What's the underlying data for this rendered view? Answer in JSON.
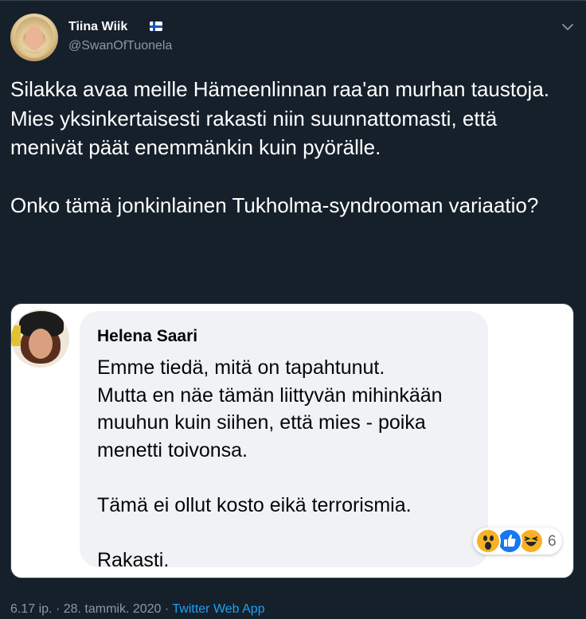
{
  "tweet": {
    "author_name": "Tiina Wiik",
    "author_handle": "@SwanOfTuonela",
    "text": "Silakka avaa meille Hämeenlinnan raa'an murhan taustoja. Mies yksinkertaisesti rakasti niin suunnattomasti, että menivät päät enemmänkin kuin pyörälle.\n\nOnko tämä jonkinlainen Tukholma-syndrooman variaatio?",
    "time": "6.17 ip.",
    "separator": "·",
    "date": "28. tammik. 2020",
    "source": "Twitter Web App"
  },
  "embedded_comment": {
    "name": "Helena Saari",
    "text": "Emme tiedä, mitä on tapahtunut.\nMutta en näe tämän liittyvän mihinkään muuhun kuin siihen, että mies - poika menetti toivonsa.\n\nTämä ei ollut kosto eikä terrorismia.\n\nRakasti.",
    "reaction_count": "6",
    "reactions": [
      "wow-icon",
      "like-icon",
      "haha-icon"
    ]
  },
  "colors": {
    "background": "#15202b",
    "secondary_text": "#8899a6",
    "link": "#1da1f2",
    "fb_bubble": "#f0f2f5",
    "fb_like": "#1877f2"
  }
}
